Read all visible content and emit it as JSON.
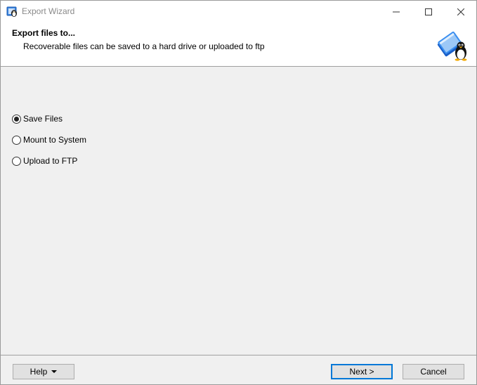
{
  "window": {
    "title": "Export Wizard"
  },
  "header": {
    "title": "Export files to...",
    "subtitle": "Recoverable files can be saved to a hard drive or uploaded to ftp"
  },
  "options": [
    {
      "label": "Save Files",
      "checked": true
    },
    {
      "label": "Mount to System",
      "checked": false
    },
    {
      "label": "Upload to FTP",
      "checked": false
    }
  ],
  "footer": {
    "help_label": "Help",
    "next_label": "Next >",
    "cancel_label": "Cancel"
  },
  "colors": {
    "accent": "#0078d7",
    "logo_blue": "#2b7de9"
  },
  "icons": {
    "app": "penguin-app-icon",
    "header": "penguin-book-icon",
    "help_menu": "caret-down-icon"
  }
}
